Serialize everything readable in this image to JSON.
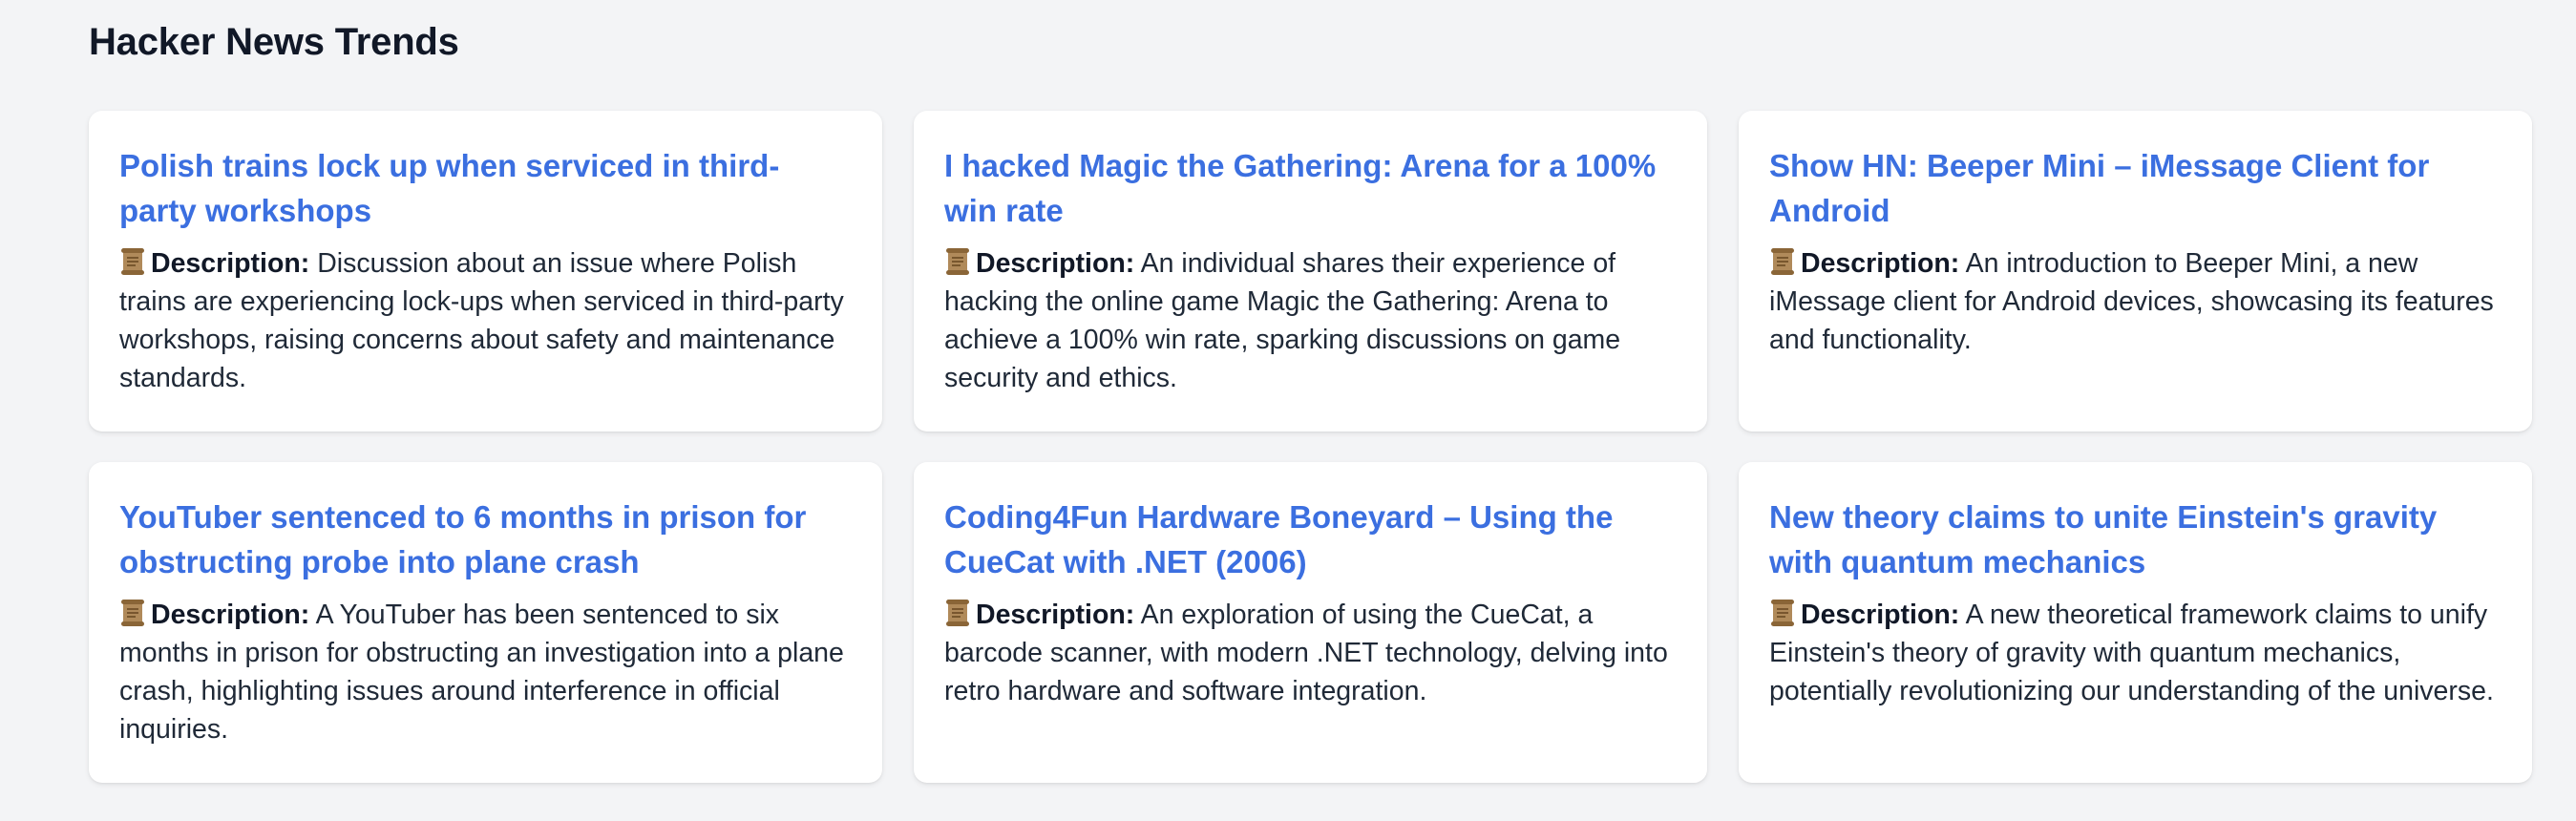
{
  "page": {
    "title": "Hacker News Trends"
  },
  "colors": {
    "background": "#f3f4f6",
    "card": "#ffffff",
    "link": "#3b6fe0",
    "text": "#1f2937"
  },
  "description_label": "Description:",
  "description_icon": "scroll-icon",
  "cards": [
    {
      "title": "Polish trains lock up when serviced in third-party workshops",
      "description": "Discussion about an issue where Polish trains are experiencing lock-ups when serviced in third-party workshops, raising concerns about safety and maintenance standards."
    },
    {
      "title": "I hacked Magic the Gathering: Arena for a 100% win rate",
      "description": "An individual shares their experience of hacking the online game Magic the Gathering: Arena to achieve a 100% win rate, sparking discussions on game security and ethics."
    },
    {
      "title": "Show HN: Beeper Mini – iMessage Client for Android",
      "description": "An introduction to Beeper Mini, a new iMessage client for Android devices, showcasing its features and functionality."
    },
    {
      "title": "YouTuber sentenced to 6 months in prison for obstructing probe into plane crash",
      "description": "A YouTuber has been sentenced to six months in prison for obstructing an investigation into a plane crash, highlighting issues around interference in official inquiries."
    },
    {
      "title": "Coding4Fun Hardware Boneyard – Using the CueCat with .NET (2006)",
      "description": "An exploration of using the CueCat, a barcode scanner, with modern .NET technology, delving into retro hardware and software integration."
    },
    {
      "title": "New theory claims to unite Einstein's gravity with quantum mechanics",
      "description": "A new theoretical framework claims to unify Einstein's theory of gravity with quantum mechanics, potentially revolutionizing our understanding of the universe."
    }
  ]
}
